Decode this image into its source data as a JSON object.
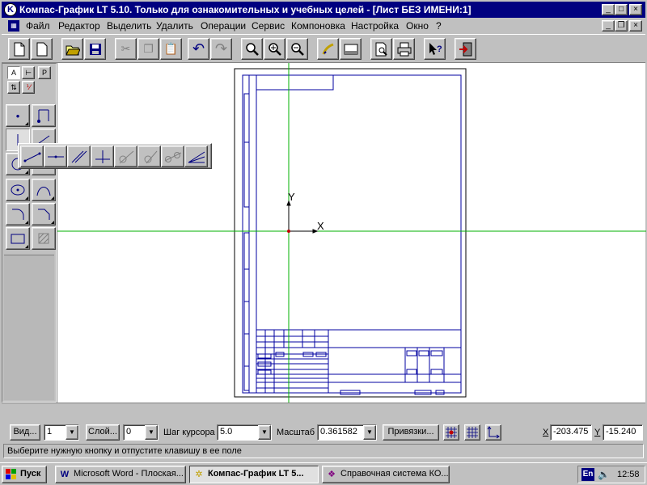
{
  "window": {
    "title": "Компас-График LT 5.10. Только для ознакомительных и учебных целей - [Лист БЕЗ ИМЕНИ:1]"
  },
  "menu": {
    "items": [
      "Файл",
      "Редактор",
      "Выделить",
      "Удалить",
      "Операции",
      "Сервис",
      "Компоновка",
      "Настройка",
      "Окно",
      "?"
    ]
  },
  "toolbar": {
    "buttons": [
      "new-sheet",
      "new-fragment",
      "open",
      "save",
      "cut",
      "copy",
      "paste",
      "undo",
      "redo",
      "zoom-fit",
      "zoom-in",
      "zoom-out",
      "pan",
      "view-window",
      "print-preview",
      "print",
      "help-pointer",
      "exit"
    ]
  },
  "palette": {
    "top_labels": [
      "Р"
    ]
  },
  "canvas": {
    "axis_y": "Y",
    "axis_x": "X"
  },
  "statusbar": {
    "view_button": "Вид...",
    "view_value": "1",
    "layer_button": "Слой...",
    "layer_value": "0",
    "step_label": "Шаг курсора",
    "step_value": "5.0",
    "scale_label": "Масштаб",
    "scale_value": "0.361582",
    "snaps_button": "Привязки...",
    "x_label": "X",
    "x_value": "-203.475",
    "y_label": "Y",
    "y_value": "-15.240",
    "hint": "Выберите нужную кнопку и отпустите клавишу в ее поле"
  },
  "taskbar": {
    "start": "Пуск",
    "tasks": [
      "Microsoft Word - Плоская...",
      "Компас-График LT 5...",
      "Справочная система КО..."
    ],
    "lang": "En",
    "clock": "12:58"
  },
  "colors": {
    "titlebar": "#000080",
    "face": "#c0c0c0",
    "drawing": "#0000a0",
    "axis_guides": "#00b000"
  }
}
